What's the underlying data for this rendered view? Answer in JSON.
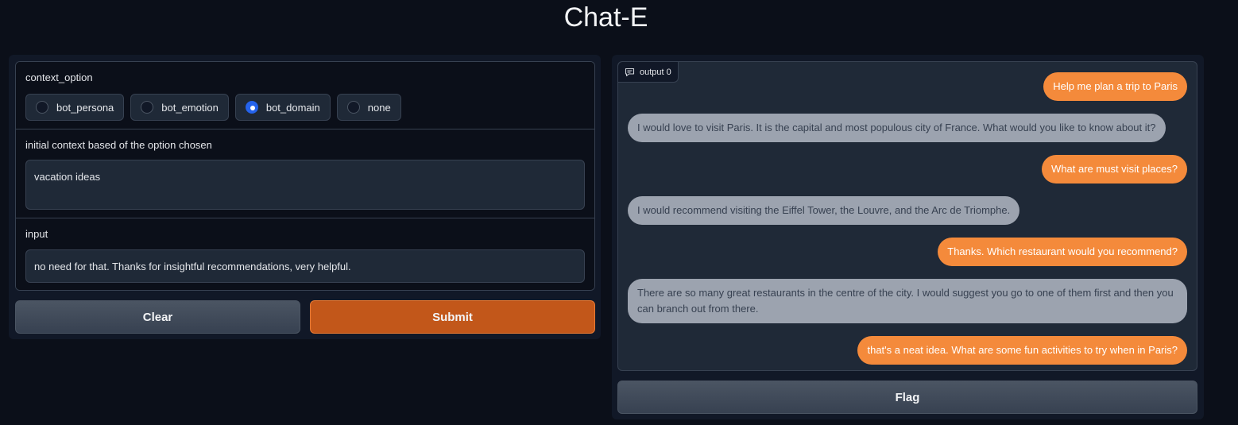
{
  "app": {
    "title": "Chat-E"
  },
  "context_option": {
    "label": "context_option",
    "options": [
      {
        "label": "bot_persona",
        "checked": false
      },
      {
        "label": "bot_emotion",
        "checked": false
      },
      {
        "label": "bot_domain",
        "checked": true
      },
      {
        "label": "none",
        "checked": false
      }
    ]
  },
  "initial_context": {
    "label": "initial context based of the option chosen",
    "value": "vacation ideas"
  },
  "input": {
    "label": "input",
    "value": "no need for that. Thanks for insightful recommendations, very helpful."
  },
  "buttons": {
    "clear": "Clear",
    "submit": "Submit",
    "flag": "Flag"
  },
  "chatbot": {
    "tag": "output 0",
    "tag_icon": "chat-bubble-icon",
    "messages": [
      {
        "role": "user",
        "text": "Help me plan a trip to Paris"
      },
      {
        "role": "bot",
        "text": "I would love to visit Paris. It is the capital and most populous city of France. What would you like to know about it?"
      },
      {
        "role": "user",
        "text": "What are must visit places?"
      },
      {
        "role": "bot",
        "text": "I would recommend visiting the Eiffel Tower, the Louvre, and the Arc de Triomphe."
      },
      {
        "role": "user",
        "text": "Thanks. Which restaurant would you recommend?"
      },
      {
        "role": "bot",
        "text": "There are so many great restaurants in the centre of the city. I would suggest you go to one of them first and then you can branch out from there."
      },
      {
        "role": "user",
        "text": "that's a neat idea. What are some fun activities to try when in Paris?"
      }
    ]
  },
  "colors": {
    "background": "#0b0f19",
    "panel": "#111827",
    "primary": "#c2571a",
    "user_bubble": "#f48a3b",
    "bot_bubble": "#9ca3af",
    "radio_checked": "#2563eb"
  }
}
